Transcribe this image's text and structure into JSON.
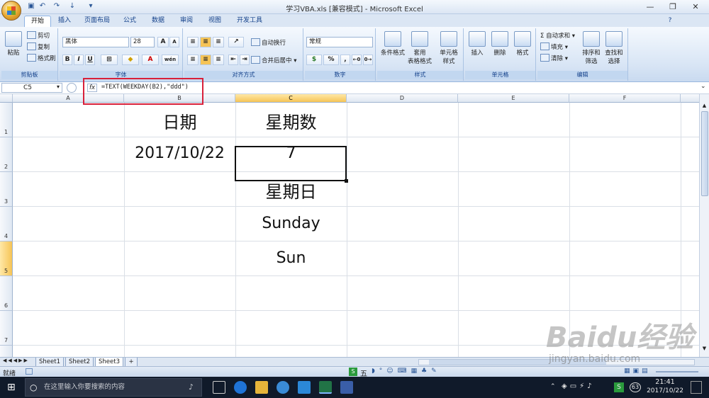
{
  "window": {
    "title": "学习VBA.xls  [兼容模式] - Microsoft Excel"
  },
  "tabs": [
    "开始",
    "插入",
    "页面布局",
    "公式",
    "数据",
    "审阅",
    "视图",
    "开发工具"
  ],
  "ribbon": {
    "clipboard": {
      "label": "剪贴板",
      "paste": "粘贴",
      "cut": "剪切",
      "copy": "复制",
      "format_painter": "格式刷"
    },
    "font": {
      "label": "字体",
      "name": "黑体",
      "size": "28",
      "bold": "B",
      "italic": "I",
      "underline": "U",
      "grow": "A",
      "shrink": "A",
      "font_color": "A",
      "wen": "wén"
    },
    "alignment": {
      "label": "对齐方式",
      "wrap": "自动换行",
      "merge": "合并后居中"
    },
    "number": {
      "label": "数字",
      "format": "常规",
      "percent": "%",
      "comma": ","
    },
    "styles": {
      "label": "样式",
      "conditional": "条件格式",
      "table1": "套用",
      "table2": "表格格式",
      "cell1": "单元格",
      "cell2": "样式"
    },
    "cells": {
      "label": "单元格",
      "insert": "插入",
      "delete": "删除",
      "format": "格式"
    },
    "editing": {
      "label": "编辑",
      "autosum": "自动求和",
      "fill": "填充",
      "clear": "清除",
      "sort1": "排序和",
      "sort2": "筛选",
      "find1": "查找和",
      "find2": "选择"
    }
  },
  "formula_bar": {
    "name_box": "C5",
    "fx": "fx",
    "formula": "=TEXT(WEEKDAY(B2),\"ddd\")"
  },
  "columns": [
    "A",
    "B",
    "C",
    "D",
    "E",
    "F"
  ],
  "rows": [
    "1",
    "2",
    "3",
    "4",
    "5",
    "6",
    "7"
  ],
  "cells": {
    "B1": "日期",
    "C1": "星期数",
    "B2": "2017/10/22",
    "C2": "7",
    "C3": "星期日",
    "C4": "Sunday",
    "C5": "Sun"
  },
  "sheets": [
    "Sheet1",
    "Sheet2",
    "Sheet3"
  ],
  "status": {
    "ready": "就绪"
  },
  "taskbar": {
    "search_placeholder": "在这里输入你要搜索的内容",
    "time": "21:41",
    "date": "2017/10/22",
    "ime": "五",
    "badge": "63"
  },
  "watermark": {
    "brand": "Baidu经验",
    "url": "jingyan.baidu.com"
  }
}
